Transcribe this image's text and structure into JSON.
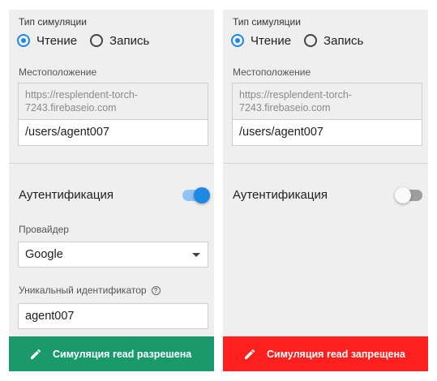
{
  "panels": [
    {
      "sim_type_label": "Тип симуляции",
      "radio_read": "Чтение",
      "radio_write": "Запись",
      "selected": "read",
      "location_label": "Местоположение",
      "db_url": "https://resplendent-torch-\n7243.firebaseio.com",
      "path": "/users/agent007",
      "auth_label": "Аутентификация",
      "auth_enabled": true,
      "provider_label": "Провайдер",
      "provider_value": "Google",
      "uid_label": "Уникальный идентификатор",
      "uid_value": "agent007",
      "result_text": "Симуляция read разрешена",
      "result_status": "allowed",
      "result_color": "#1a9a6c",
      "icons": [
        "pencil-icon",
        "question-icon",
        "dropdown-caret-icon"
      ]
    },
    {
      "sim_type_label": "Тип симуляции",
      "radio_read": "Чтение",
      "radio_write": "Запись",
      "selected": "read",
      "location_label": "Местоположение",
      "db_url": "https://resplendent-torch-\n7243.firebaseio.com",
      "path": "/users/agent007",
      "auth_label": "Аутентификация",
      "auth_enabled": false,
      "result_text": "Симуляция read запрещена",
      "result_status": "denied",
      "result_color": "#ff1f1f",
      "icons": [
        "pencil-icon"
      ]
    }
  ],
  "colors": {
    "accent": "#1e88e5",
    "allowed": "#1a9a6c",
    "denied": "#ff1f1f"
  }
}
